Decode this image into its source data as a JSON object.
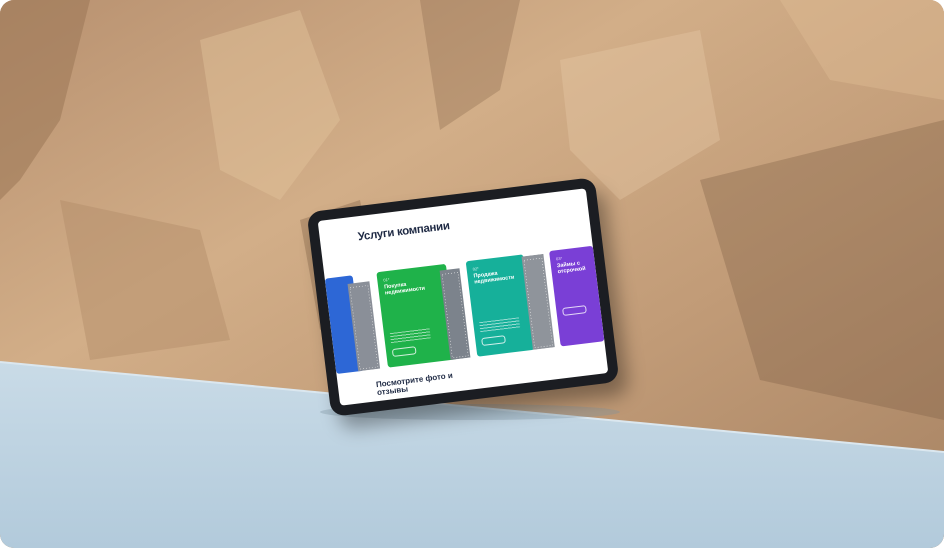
{
  "tablet_screen": {
    "title": "Услуги компании",
    "cards": [
      {
        "tag": "",
        "name": "",
        "color": "#2d67d6"
      },
      {
        "tag": "01*",
        "name": "Покупка недвижимости",
        "color": "#1fb24a"
      },
      {
        "tag": "02*",
        "name": "Продажа недвижимости",
        "color": "#16b09a"
      },
      {
        "tag": "03*",
        "name": "Займы с отсрочкой",
        "color": "#7a3fd6"
      }
    ],
    "subtitle": "Посмотрите фото и отзывы"
  },
  "colors": {
    "sky_blue_floor": "#bcd2e0",
    "sandstone": "#c9a37d",
    "tablet_frame": "#1b1d22"
  }
}
